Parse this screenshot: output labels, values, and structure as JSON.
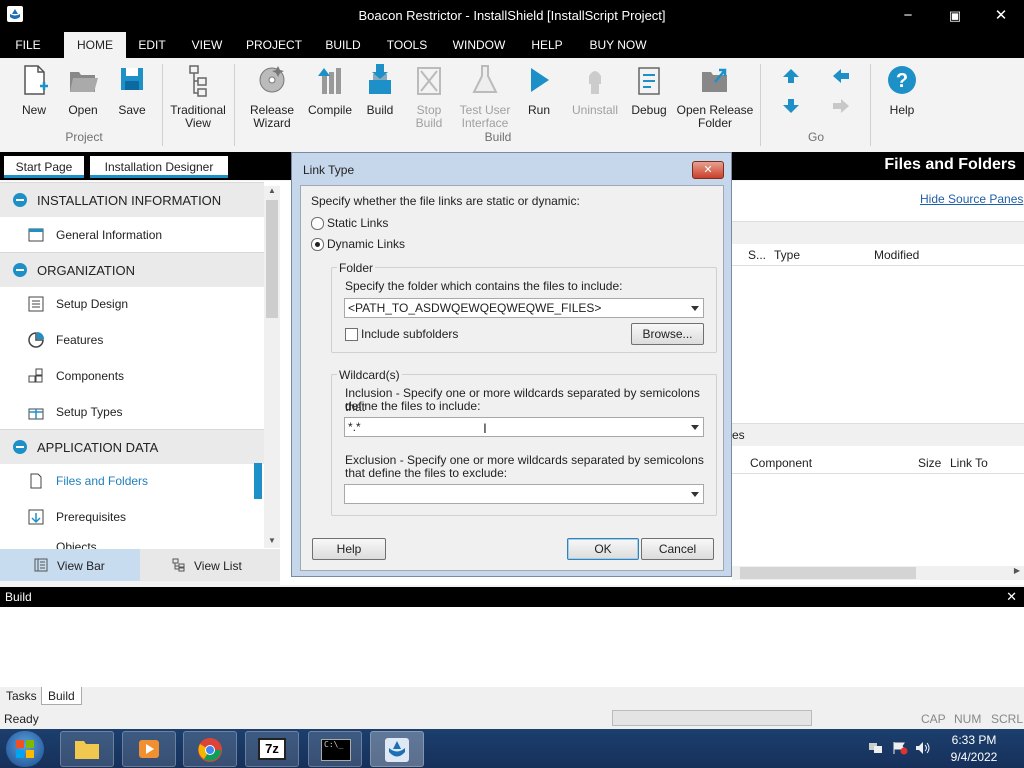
{
  "window": {
    "title": "Boacon Restrictor - InstallShield [InstallScript Project]",
    "minimize": "−",
    "restore": "▣",
    "close": "✕"
  },
  "menu": [
    "FILE",
    "HOME",
    "EDIT",
    "VIEW",
    "PROJECT",
    "BUILD",
    "TOOLS",
    "WINDOW",
    "HELP",
    "BUY NOW"
  ],
  "ribbon": {
    "new": "New",
    "open": "Open",
    "save": "Save",
    "group_project": "Project",
    "traditional_view": [
      "Traditional",
      "View"
    ],
    "release_wizard": [
      "Release",
      "Wizard"
    ],
    "compile": "Compile",
    "build": "Build",
    "stop_build": [
      "Stop",
      "Build"
    ],
    "test_ui": [
      "Test User",
      "Interface"
    ],
    "run": "Run",
    "uninstall": "Uninstall",
    "debug": "Debug",
    "open_release": [
      "Open Release",
      "Folder"
    ],
    "group_build": "Build",
    "group_go": "Go",
    "help": "Help"
  },
  "doc_tabs": {
    "start": "Start Page",
    "designer": "Installation Designer"
  },
  "page_title": "Files and Folders",
  "left_nav": {
    "sections": [
      "INSTALLATION INFORMATION",
      "ORGANIZATION",
      "APPLICATION DATA"
    ],
    "general_information": "General Information",
    "setup_design": "Setup Design",
    "features": "Features",
    "components": "Components",
    "setup_types": "Setup Types",
    "files_and_folders": "Files and Folders",
    "prerequisites": "Prerequisites",
    "partial": "Objects"
  },
  "view_bar": {
    "view_bar": "View Bar",
    "view_list": "View List"
  },
  "right": {
    "hide_source": "Hide Source Panes",
    "upper_cols": [
      "S...",
      "Type",
      "Modified"
    ],
    "lower_partial": "es",
    "lower_cols": [
      "Component",
      "Size",
      "Link To"
    ]
  },
  "dialog": {
    "title": "Link Type",
    "close": "✕",
    "prompt": "Specify whether the file links are static or dynamic:",
    "static": "Static Links",
    "dynamic": "Dynamic Links",
    "folder_group": "Folder",
    "folder_prompt": "Specify the folder which contains the files to include:",
    "folder_value": "<PATH_TO_ASDWQEWQEQWEQWE_FILES>",
    "include_subfolders": "Include subfolders",
    "browse": "Browse...",
    "wildcards_group": "Wildcard(s)",
    "inclusion_line1": "Inclusion - Specify one or more wildcards separated by semicolons that",
    "inclusion_line2": "define the files to include:",
    "inclusion_value": "*.*",
    "exclusion_line1": "Exclusion - Specify one or more wildcards separated by semicolons",
    "exclusion_line2": "that define the files to exclude:",
    "exclusion_value": "",
    "help": "Help",
    "ok": "OK",
    "cancel": "Cancel"
  },
  "build_panel": {
    "title": "Build",
    "close": "✕"
  },
  "bottom_tabs": {
    "tasks": "Tasks",
    "build": "Build"
  },
  "status": {
    "ready": "Ready",
    "cap": "CAP",
    "num": "NUM",
    "scrl": "SCRL"
  },
  "taskbar": {
    "time": "6:33 PM",
    "date": "9/4/2022"
  },
  "colors": {
    "accent": "#1e90c8",
    "titlebar": "#000000",
    "dialog_frame": "#c6d7ec",
    "taskbar": "#1c3f6e"
  }
}
